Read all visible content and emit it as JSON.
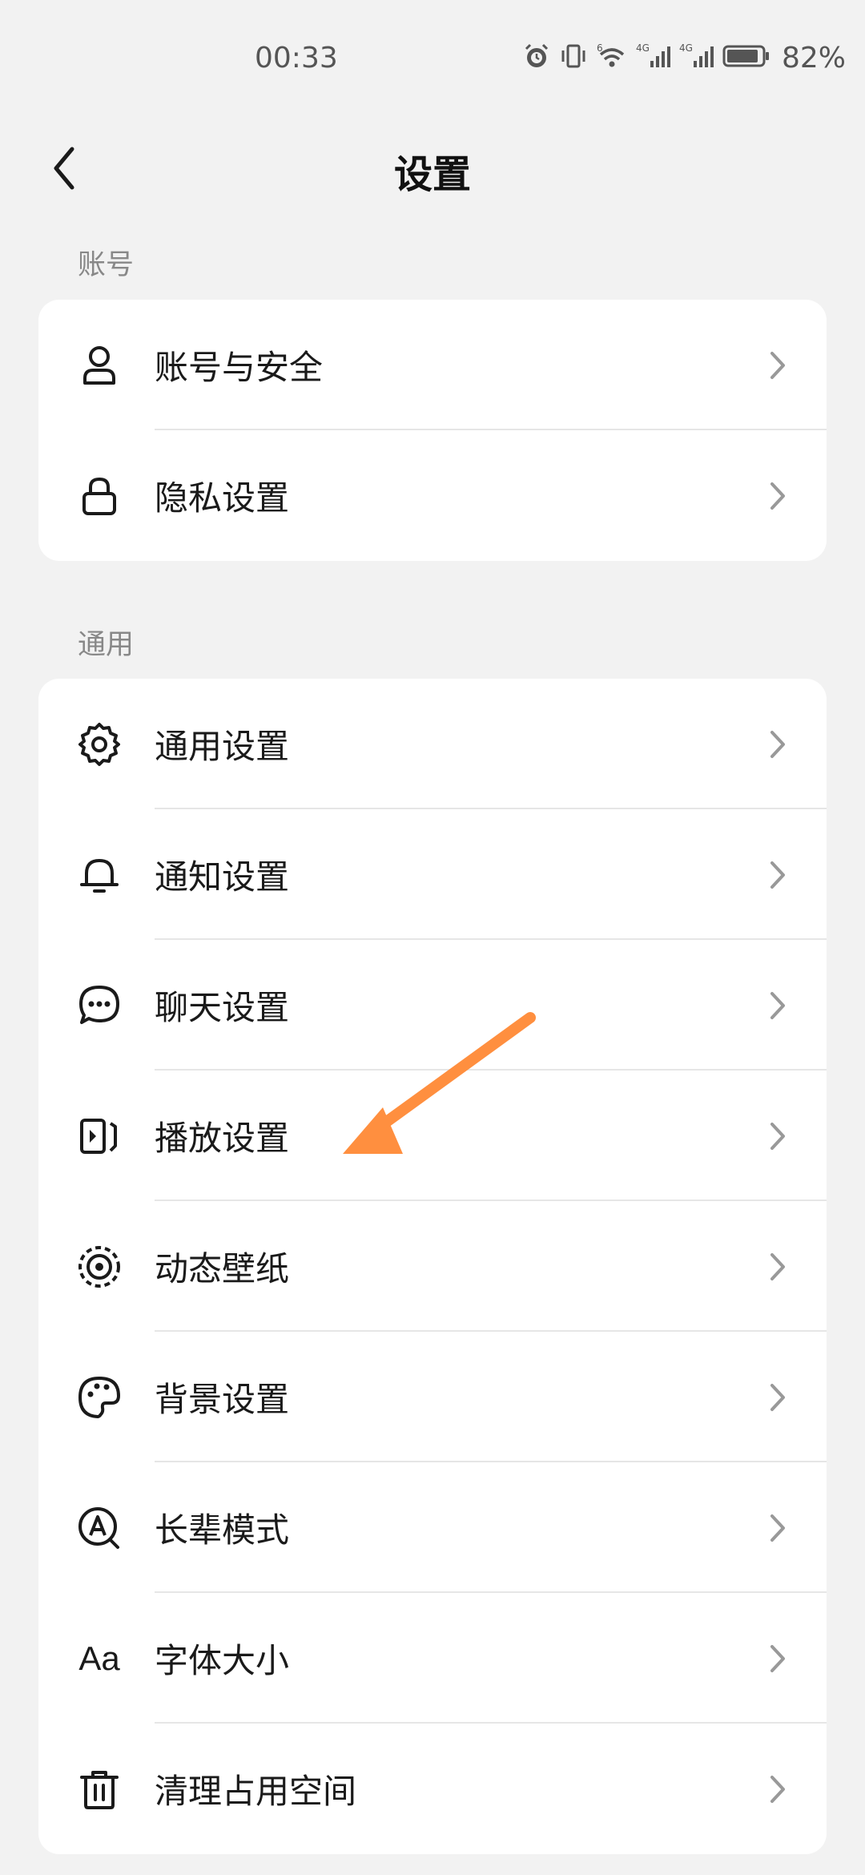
{
  "status": {
    "time": "00:33",
    "battery_pct": "82%",
    "icons": [
      "alarm-icon",
      "vibrate-icon",
      "wifi-icon",
      "signal-4g-icon",
      "signal-4g-icon",
      "battery-icon"
    ],
    "net1": "4G",
    "net2": "4G",
    "wifi_tag": "6"
  },
  "nav": {
    "title": "设置"
  },
  "sections": [
    {
      "header": "账号",
      "items": [
        {
          "label": "账号与安全",
          "icon": "user-icon"
        },
        {
          "label": "隐私设置",
          "icon": "lock-icon"
        }
      ]
    },
    {
      "header": "通用",
      "items": [
        {
          "label": "通用设置",
          "icon": "gear-icon"
        },
        {
          "label": "通知设置",
          "icon": "bell-icon"
        },
        {
          "label": "聊天设置",
          "icon": "chat-bubble-icon"
        },
        {
          "label": "播放设置",
          "icon": "play-screen-icon"
        },
        {
          "label": "动态壁纸",
          "icon": "live-wallpaper-icon"
        },
        {
          "label": "背景设置",
          "icon": "palette-icon"
        },
        {
          "label": "长辈模式",
          "icon": "elder-mode-icon"
        },
        {
          "label": "字体大小",
          "icon": "font-size-icon",
          "glyph": "Aa"
        },
        {
          "label": "清理占用空间",
          "icon": "trash-icon"
        }
      ]
    }
  ],
  "annotation": {
    "color": "#ff8f3f"
  }
}
